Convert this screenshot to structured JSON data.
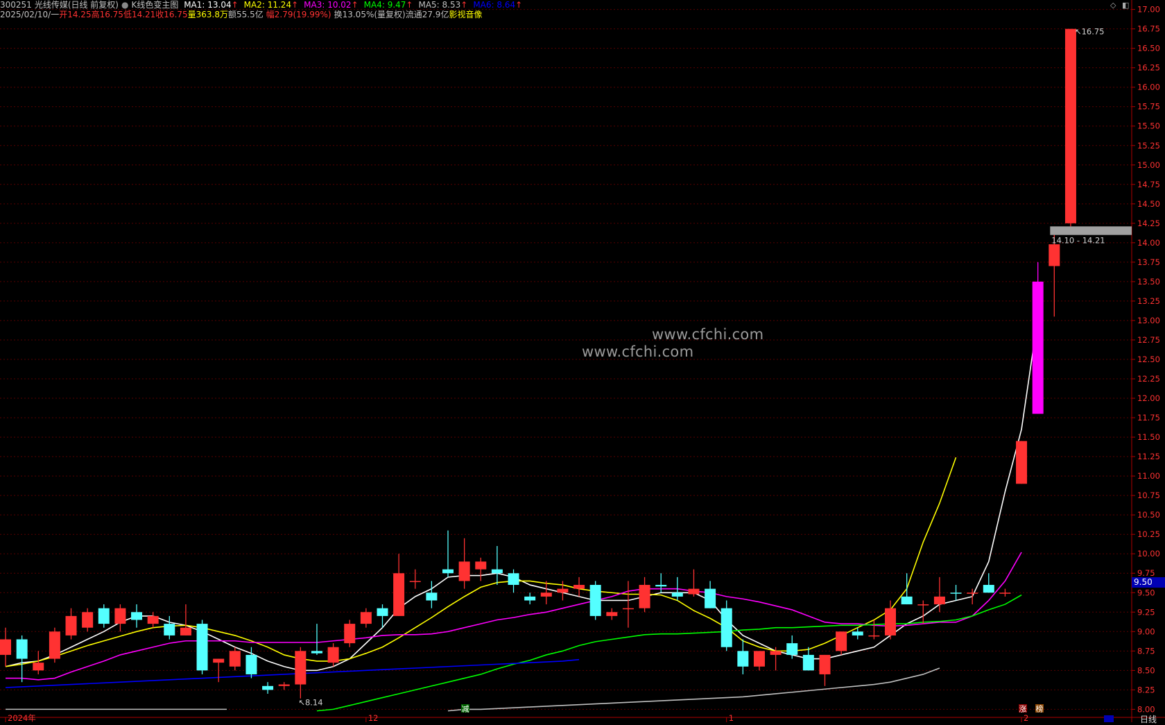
{
  "header": {
    "title_code": "300251",
    "title_name": "光线传媒(日线 前复权)",
    "indicator_name": "K线色变主图",
    "ma": [
      {
        "label": "MA1: 13.04",
        "color": "#ffffff"
      },
      {
        "label": "MA2: 11.24",
        "color": "#ffff00"
      },
      {
        "label": "MA3: 10.02",
        "color": "#ff00ff"
      },
      {
        "label": "MA4: 9.47",
        "color": "#00ff00"
      },
      {
        "label": "MA5: 8.53",
        "color": "#c0c0c0"
      },
      {
        "label": "MA6: 8.64",
        "color": "#0000ff"
      }
    ],
    "ma_arrow": "↑",
    "date": "2025/02/10/一",
    "open": "开14.25",
    "high": "高16.75",
    "low": "低14.21",
    "close": "收16.75",
    "volume": "量363.8万",
    "amount": "额55.5亿",
    "change": "幅2.79(19.99%)",
    "turnover": "换13.05%(量复权)",
    "float_cap": "流通27.9亿",
    "sector": "影视音像"
  },
  "watermarks": [
    "www.cfchi.com",
    "www.cfchi.com"
  ],
  "annotations": {
    "high_marker": "16.75",
    "low_marker": "8.14",
    "gap_range": "14.10 - 14.21",
    "current_price": "9.50",
    "badge_jian": "减",
    "badge_zhang": "涨",
    "badge_bang": "榜"
  },
  "period_label": "日线",
  "chart_data": {
    "type": "candlestick",
    "ylim": [
      7.95,
      17.05
    ],
    "y_ticks": [
      8.0,
      8.25,
      8.5,
      8.75,
      9.0,
      9.25,
      9.5,
      9.75,
      10.0,
      10.25,
      10.5,
      10.75,
      11.0,
      11.25,
      11.5,
      11.75,
      12.0,
      12.25,
      12.5,
      12.75,
      13.0,
      13.25,
      13.5,
      13.75,
      14.0,
      14.25,
      14.5,
      14.75,
      15.0,
      15.25,
      15.5,
      15.75,
      16.0,
      16.25,
      16.5,
      16.75,
      17.0
    ],
    "x_labels": [
      {
        "index": 0,
        "label": "2024年"
      },
      {
        "index": 22,
        "label": "12"
      },
      {
        "index": 44,
        "label": "1"
      },
      {
        "index": 62,
        "label": "2"
      }
    ],
    "candles": [
      [
        8.9,
        9.05,
        8.55,
        8.7,
        "red"
      ],
      [
        8.9,
        8.95,
        8.35,
        8.65,
        "cyan"
      ],
      [
        8.5,
        8.75,
        8.45,
        8.6,
        "red"
      ],
      [
        8.65,
        9.05,
        8.6,
        9.0,
        "red"
      ],
      [
        8.95,
        9.3,
        8.9,
        9.2,
        "red"
      ],
      [
        9.05,
        9.3,
        9.0,
        9.25,
        "red"
      ],
      [
        9.1,
        9.35,
        9.05,
        9.3,
        "cyan"
      ],
      [
        9.1,
        9.35,
        9.0,
        9.3,
        "red"
      ],
      [
        9.15,
        9.35,
        9.05,
        9.25,
        "cyan"
      ],
      [
        9.1,
        9.25,
        9.05,
        9.2,
        "red"
      ],
      [
        8.95,
        9.2,
        8.9,
        9.1,
        "cyan"
      ],
      [
        8.95,
        9.35,
        8.95,
        9.05,
        "red"
      ],
      [
        8.5,
        9.15,
        8.45,
        9.1,
        "cyan"
      ],
      [
        8.6,
        8.65,
        8.35,
        8.65,
        "red"
      ],
      [
        8.55,
        8.8,
        8.5,
        8.75,
        "red"
      ],
      [
        8.45,
        8.8,
        8.4,
        8.7,
        "cyan"
      ],
      [
        8.25,
        8.35,
        8.2,
        8.3,
        "cyan"
      ],
      [
        8.3,
        8.35,
        8.25,
        8.32,
        "red"
      ],
      [
        8.32,
        8.8,
        8.14,
        8.75,
        "red"
      ],
      [
        8.75,
        9.1,
        8.7,
        8.72,
        "cyan"
      ],
      [
        8.6,
        8.85,
        8.55,
        8.8,
        "red"
      ],
      [
        8.85,
        9.15,
        8.8,
        9.1,
        "red"
      ],
      [
        9.1,
        9.3,
        9.05,
        9.25,
        "red"
      ],
      [
        9.2,
        9.35,
        9.05,
        9.3,
        "cyan"
      ],
      [
        9.2,
        10.0,
        9.2,
        9.75,
        "red"
      ],
      [
        9.65,
        9.8,
        9.55,
        9.65,
        "red"
      ],
      [
        9.5,
        9.65,
        9.3,
        9.4,
        "cyan"
      ],
      [
        9.8,
        10.3,
        9.7,
        9.75,
        "cyan"
      ],
      [
        9.65,
        10.2,
        9.55,
        9.9,
        "red"
      ],
      [
        9.8,
        9.95,
        9.65,
        9.9,
        "red"
      ],
      [
        9.75,
        10.1,
        9.6,
        9.8,
        "cyan"
      ],
      [
        9.75,
        9.8,
        9.5,
        9.6,
        "cyan"
      ],
      [
        9.4,
        9.5,
        9.35,
        9.45,
        "cyan"
      ],
      [
        9.5,
        9.65,
        9.35,
        9.45,
        "red"
      ],
      [
        9.5,
        9.65,
        9.4,
        9.55,
        "red"
      ],
      [
        9.55,
        9.7,
        9.45,
        9.6,
        "red"
      ],
      [
        9.6,
        9.65,
        9.15,
        9.2,
        "cyan"
      ],
      [
        9.2,
        9.3,
        9.15,
        9.25,
        "red"
      ],
      [
        9.3,
        9.65,
        9.05,
        9.3,
        "red"
      ],
      [
        9.3,
        9.7,
        9.25,
        9.6,
        "red"
      ],
      [
        9.58,
        9.75,
        9.5,
        9.6,
        "cyan"
      ],
      [
        9.45,
        9.7,
        9.4,
        9.5,
        "cyan"
      ],
      [
        9.48,
        9.8,
        9.45,
        9.55,
        "red"
      ],
      [
        9.55,
        9.65,
        9.3,
        9.3,
        "cyan"
      ],
      [
        9.3,
        9.4,
        8.75,
        8.8,
        "cyan"
      ],
      [
        8.75,
        8.9,
        8.45,
        8.55,
        "cyan"
      ],
      [
        8.55,
        8.7,
        8.5,
        8.75,
        "red"
      ],
      [
        8.7,
        8.8,
        8.5,
        8.75,
        "red"
      ],
      [
        8.85,
        8.95,
        8.65,
        8.7,
        "cyan"
      ],
      [
        8.5,
        8.8,
        8.5,
        8.7,
        "cyan"
      ],
      [
        8.45,
        8.7,
        8.3,
        8.7,
        "red"
      ],
      [
        8.75,
        9.0,
        8.7,
        9.0,
        "red"
      ],
      [
        9.0,
        9.05,
        8.9,
        8.95,
        "cyan"
      ],
      [
        8.95,
        9.15,
        8.9,
        8.95,
        "red"
      ],
      [
        8.95,
        9.4,
        8.9,
        9.3,
        "red"
      ],
      [
        9.45,
        9.75,
        9.35,
        9.35,
        "cyan"
      ],
      [
        9.35,
        9.4,
        9.1,
        9.35,
        "red"
      ],
      [
        9.35,
        9.7,
        9.25,
        9.45,
        "red"
      ],
      [
        9.5,
        9.6,
        9.4,
        9.5,
        "cyan"
      ],
      [
        9.5,
        9.55,
        9.35,
        9.5,
        "red"
      ],
      [
        9.6,
        9.75,
        9.5,
        9.5,
        "cyan"
      ],
      [
        9.5,
        9.55,
        9.45,
        9.5,
        "red"
      ],
      [
        10.9,
        11.45,
        10.9,
        11.45,
        "red"
      ],
      [
        11.8,
        13.75,
        11.8,
        13.5,
        "magenta"
      ],
      [
        13.7,
        14.1,
        13.05,
        13.98,
        "red"
      ],
      [
        14.25,
        16.75,
        14.21,
        16.75,
        "red"
      ]
    ],
    "series": [
      {
        "name": "MA1",
        "color": "#ffffff",
        "start": 0,
        "values": [
          8.55,
          8.6,
          8.62,
          8.7,
          8.8,
          8.9,
          9.0,
          9.12,
          9.2,
          9.2,
          9.12,
          9.08,
          9.0,
          8.9,
          8.8,
          8.72,
          8.62,
          8.55,
          8.5,
          8.5,
          8.55,
          8.65,
          8.85,
          9.05,
          9.3,
          9.45,
          9.55,
          9.7,
          9.72,
          9.72,
          9.75,
          9.7,
          9.6,
          9.55,
          9.5,
          9.45,
          9.4,
          9.4,
          9.4,
          9.45,
          9.5,
          9.5,
          9.5,
          9.4,
          9.15,
          8.95,
          8.85,
          8.75,
          8.7,
          8.65,
          8.65,
          8.7,
          8.75,
          8.8,
          8.95,
          9.1,
          9.2,
          9.35,
          9.4,
          9.45,
          9.9,
          10.8,
          11.6,
          13.04
        ]
      },
      {
        "name": "MA2",
        "color": "#ffff00",
        "start": 0,
        "values": [
          8.55,
          8.58,
          8.62,
          8.68,
          8.75,
          8.82,
          8.88,
          8.94,
          9.0,
          9.05,
          9.07,
          9.08,
          9.05,
          9.0,
          8.95,
          8.88,
          8.8,
          8.7,
          8.65,
          8.62,
          8.62,
          8.65,
          8.72,
          8.8,
          8.92,
          9.05,
          9.18,
          9.32,
          9.45,
          9.57,
          9.63,
          9.65,
          9.65,
          9.62,
          9.6,
          9.55,
          9.52,
          9.5,
          9.48,
          9.48,
          9.47,
          9.4,
          9.27,
          9.17,
          9.05,
          8.88,
          8.8,
          8.75,
          8.75,
          8.77,
          8.85,
          8.95,
          9.05,
          9.15,
          9.28,
          9.55,
          10.15,
          10.65,
          11.24
        ]
      },
      {
        "name": "MA3",
        "color": "#ff00ff",
        "start": 0,
        "values": [
          8.4,
          8.4,
          8.38,
          8.4,
          8.48,
          8.55,
          8.62,
          8.7,
          8.75,
          8.8,
          8.85,
          8.88,
          8.88,
          8.88,
          8.88,
          8.86,
          8.86,
          8.86,
          8.86,
          8.86,
          8.88,
          8.9,
          8.92,
          8.95,
          8.96,
          8.96,
          8.97,
          9.0,
          9.05,
          9.1,
          9.15,
          9.18,
          9.22,
          9.25,
          9.3,
          9.35,
          9.4,
          9.45,
          9.52,
          9.55,
          9.55,
          9.55,
          9.52,
          9.5,
          9.45,
          9.42,
          9.38,
          9.33,
          9.28,
          9.2,
          9.12,
          9.1,
          9.1,
          9.08,
          9.07,
          9.08,
          9.1,
          9.12,
          9.12,
          9.2,
          9.4,
          9.65,
          10.02
        ]
      },
      {
        "name": "MA4",
        "color": "#00ff00",
        "start": 19,
        "values": [
          7.98,
          8.0,
          8.05,
          8.1,
          8.15,
          8.2,
          8.25,
          8.3,
          8.35,
          8.4,
          8.45,
          8.52,
          8.58,
          8.63,
          8.7,
          8.75,
          8.82,
          8.87,
          8.9,
          8.93,
          8.96,
          8.97,
          8.97,
          8.98,
          8.99,
          9.0,
          9.02,
          9.03,
          9.05,
          9.05,
          9.06,
          9.07,
          9.08,
          9.08,
          9.09,
          9.1,
          9.1,
          9.12,
          9.13,
          9.15,
          9.2,
          9.28,
          9.35,
          9.47
        ]
      },
      {
        "name": "MA5",
        "color": "#c0c0c0",
        "start": 27,
        "values": [
          7.98,
          8.0,
          8.0,
          8.01,
          8.02,
          8.03,
          8.04,
          8.05,
          8.06,
          8.07,
          8.08,
          8.09,
          8.1,
          8.11,
          8.12,
          8.13,
          8.14,
          8.15,
          8.16,
          8.18,
          8.2,
          8.22,
          8.24,
          8.26,
          8.28,
          8.3,
          8.32,
          8.35,
          8.4,
          8.45,
          8.53
        ]
      },
      {
        "name": "MA6",
        "color": "#0000ff",
        "start": 0,
        "values": [
          8.28,
          8.29,
          8.3,
          8.31,
          8.32,
          8.33,
          8.34,
          8.35,
          8.36,
          8.37,
          8.38,
          8.39,
          8.4,
          8.41,
          8.42,
          8.43,
          8.44,
          8.45,
          8.46,
          8.47,
          8.48,
          8.49,
          8.5,
          8.51,
          8.52,
          8.53,
          8.54,
          8.55,
          8.56,
          8.57,
          8.58,
          8.59,
          8.6,
          8.61,
          8.62,
          8.64
        ]
      }
    ]
  }
}
